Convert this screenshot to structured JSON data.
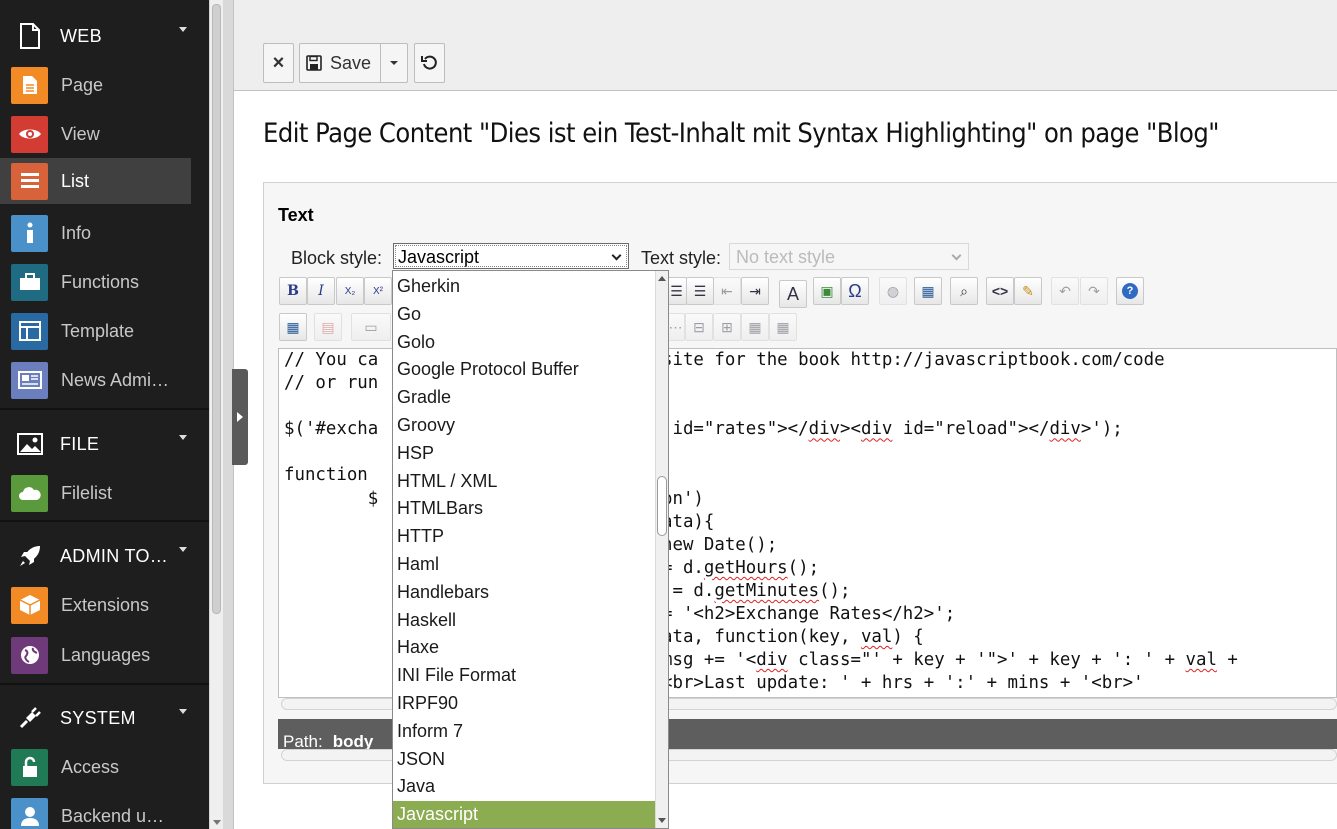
{
  "sidebar": {
    "groups": [
      {
        "label": "WEB",
        "icon": "page-outline-icon"
      },
      {
        "label": "FILE",
        "icon": "image-icon"
      },
      {
        "label": "ADMIN TO…",
        "icon": "rocket-icon"
      },
      {
        "label": "SYSTEM",
        "icon": "plug-icon"
      }
    ],
    "modules": [
      {
        "label": "Page",
        "icon": "page-icon",
        "color": "#f28b25"
      },
      {
        "label": "View",
        "icon": "eye-icon",
        "color": "#d33c32"
      },
      {
        "label": "List",
        "icon": "list-icon",
        "color": "#d8633b"
      },
      {
        "label": "Info",
        "icon": "info-icon",
        "color": "#4a90c9"
      },
      {
        "label": "Functions",
        "icon": "briefcase-icon",
        "color": "#1f6b82"
      },
      {
        "label": "Template",
        "icon": "template-icon",
        "color": "#2a6aa3"
      },
      {
        "label": "News Admi…",
        "icon": "newspaper-icon",
        "color": "#6b7ebd"
      },
      {
        "label": "Filelist",
        "icon": "cloud-icon",
        "color": "#5a9a3c"
      },
      {
        "label": "Extensions",
        "icon": "box-icon",
        "color": "#f28b25"
      },
      {
        "label": "Languages",
        "icon": "globe-icon",
        "color": "#6f3a7a"
      },
      {
        "label": "Access",
        "icon": "lock-icon",
        "color": "#1f7a55"
      },
      {
        "label": "Backend u…",
        "icon": "user-icon",
        "color": "#4a90c9"
      }
    ]
  },
  "toolbar": {
    "close_label": "×",
    "save_label": "Save"
  },
  "page_title": "Edit Page Content \"Dies ist ein Test-Inhalt mit Syntax Highlighting\" on page \"Blog\"",
  "field": {
    "label": "Text",
    "block_style_label": "Block style:",
    "block_style_value": "Javascript",
    "text_style_label": "Text style:",
    "text_style_value": "No text style"
  },
  "editor": {
    "lines": [
      "// You ca",
      "// or run",
      "",
      "$('#excha",
      "",
      "function ",
      "        $",
      "",
      "",
      "",
      "",
      "",
      "",
      ""
    ],
    "right_lines": [
      "site for the book http://javascriptbook.com/code",
      "",
      "",
      " id=\"rates\"></div><div id=\"reload\"></div>');",
      "",
      "",
      "on')",
      "ata){",
      "new Date();",
      "= d.getHours();",
      " = d.getMinutes();",
      "= '<h2>Exchange Rates</h2>';",
      "ata, function(key, val) {",
      "msg += '<div class=\"' + key + '\">' + key + ': ' + val +"
    ],
    "partial_last_line": "<br>Last update: ' + hrs + ':' + mins + '<br>'"
  },
  "path_bar": {
    "label": "Path:",
    "value": "body"
  },
  "dropdown": {
    "options": [
      "Gherkin",
      "Go",
      "Golo",
      "Google Protocol Buffer",
      "Gradle",
      "Groovy",
      "HSP",
      "HTML / XML",
      "HTMLBars",
      "HTTP",
      "Haml",
      "Handlebars",
      "Haskell",
      "Haxe",
      "INI File Format",
      "IRPF90",
      "Inform 7",
      "JSON",
      "Java",
      "Javascript"
    ],
    "selected": "Javascript",
    "highlight_color": "#8cac52"
  }
}
